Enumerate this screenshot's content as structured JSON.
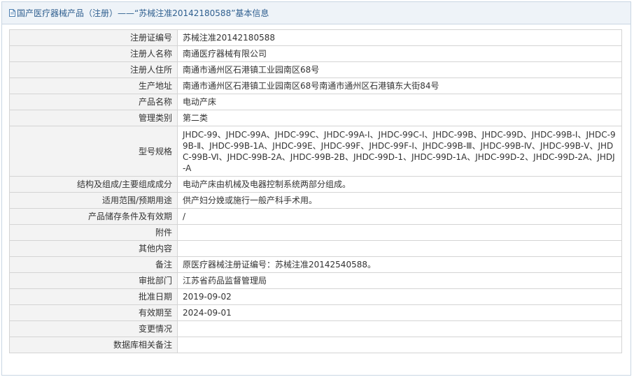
{
  "header": {
    "title": "国产医疗器械产品（注册）——“苏械注准20142180588”基本信息"
  },
  "rows": [
    {
      "label": "注册证编号",
      "value": "苏械注准20142180588"
    },
    {
      "label": "注册人名称",
      "value": "南通医疗器械有限公司"
    },
    {
      "label": "注册人住所",
      "value": "南通市通州区石港镇工业园南区68号"
    },
    {
      "label": "生产地址",
      "value": "南通市通州区石港镇工业园南区68号南通市通州区石港镇东大街84号"
    },
    {
      "label": "产品名称",
      "value": "电动产床"
    },
    {
      "label": "管理类别",
      "value": "第二类"
    },
    {
      "label": "型号规格",
      "value": "JHDC-99、JHDC-99A、JHDC-99C、JHDC-99A-Ⅰ、JHDC-99C-Ⅰ、JHDC-99B、JHDC-99D、JHDC-99B-Ⅰ、JHDC-99B-Ⅱ、JHDC-99B-1A、JHDC-99E、JHDC-99F、JHDC-99F-Ⅰ、JHDC-99B-Ⅲ、JHDC-99B-Ⅳ、JHDC-99B-Ⅴ、JHDC-99B-Ⅵ、JHDC-99B-2A、JHDC-99B-2B、JHDC-99D-1、JHDC-99D-1A、JHDC-99D-2、JHDC-99D-2A、JHDJ-A"
    },
    {
      "label": "结构及组成/主要组成成分",
      "value": "电动产床由机械及电器控制系统两部分组成。"
    },
    {
      "label": "适用范围/预期用途",
      "value": "供产妇分娩或施行一般产科手术用。"
    },
    {
      "label": "产品储存条件及有效期",
      "value": "/"
    },
    {
      "label": "附件",
      "value": ""
    },
    {
      "label": "其他内容",
      "value": ""
    },
    {
      "label": "备注",
      "value": "原医疗器械注册证编号：苏械注准20142540588。"
    },
    {
      "label": "审批部门",
      "value": "江苏省药品监督管理局"
    },
    {
      "label": "批准日期",
      "value": "2019-09-02"
    },
    {
      "label": "有效期至",
      "value": "2024-09-01"
    },
    {
      "label": "变更情况",
      "value": ""
    },
    {
      "label": "数据库相关备注",
      "value": ""
    }
  ],
  "icons": {
    "header_icon": "document-icon"
  },
  "colors": {
    "header_text": "#2f5f8f",
    "header_bg": "#eef3f8",
    "label_bg": "#f3f3f3",
    "border": "#d4d4d4"
  }
}
